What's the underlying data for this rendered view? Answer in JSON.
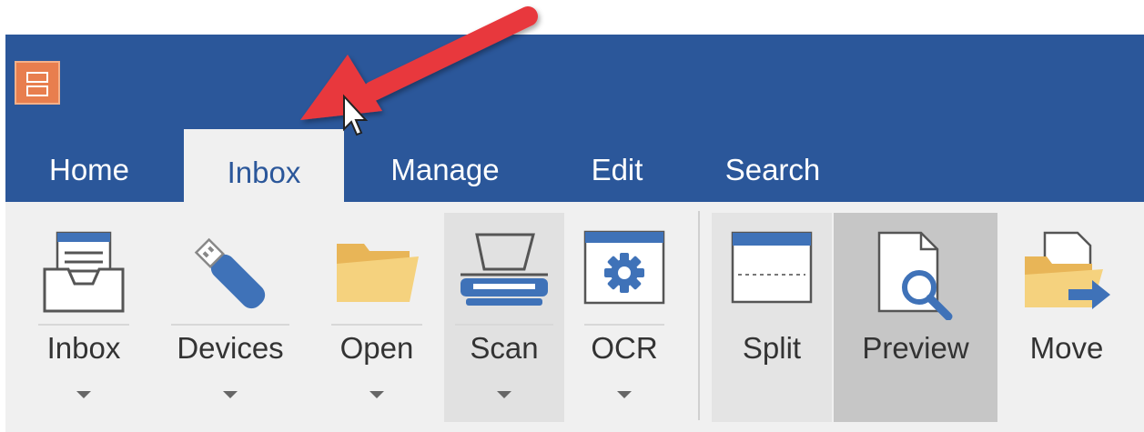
{
  "tabs": [
    {
      "label": "Home"
    },
    {
      "label": "Inbox",
      "active": true
    },
    {
      "label": "Manage"
    },
    {
      "label": "Edit"
    },
    {
      "label": "Search"
    }
  ],
  "ribbon": {
    "inbox_label": "Inbox",
    "devices_label": "Devices",
    "open_label": "Open",
    "scan_label": "Scan",
    "ocr_label": "OCR",
    "split_label": "Split",
    "preview_label": "Preview",
    "move_label": "Move"
  },
  "colors": {
    "titlebar": "#2b579a",
    "ribbon_background": "#f0f0f0",
    "pressed_button": "#c6c6c6",
    "hover_button": "#e1e1e1",
    "annotation_arrow": "#e8383d",
    "app_icon": "#e87e4e",
    "folder": "#f0c76e",
    "accent_blue": "#3f72b8"
  },
  "icons": {
    "app": "file-cabinet-icon",
    "inbox": "inbox-tray-icon",
    "devices": "usb-drive-icon",
    "open": "folder-icon",
    "scan": "scanner-icon",
    "ocr": "gear-window-icon",
    "split": "split-page-icon",
    "preview": "document-magnifier-icon",
    "move": "folder-move-icon"
  },
  "annotation": {
    "type": "callout-arrow",
    "target": "tab-inbox"
  }
}
